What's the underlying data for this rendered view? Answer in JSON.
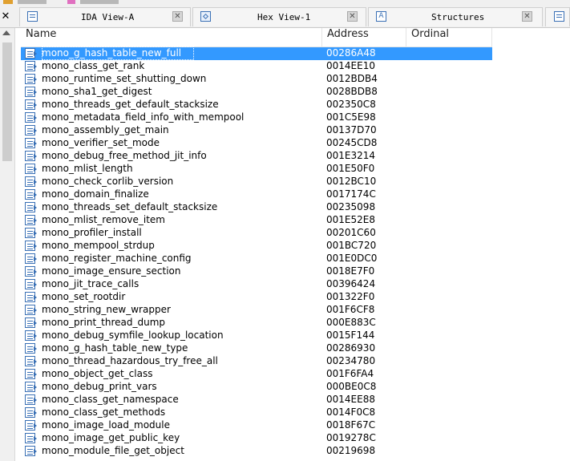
{
  "tabs": [
    {
      "label": "IDA View-A",
      "icon": "ida-view-icon"
    },
    {
      "label": "Hex View-1",
      "icon": "hex-view-icon"
    },
    {
      "label": "Structures",
      "icon": "structures-icon"
    }
  ],
  "table": {
    "columns": [
      "Name",
      "Address",
      "Ordinal"
    ],
    "selected_index": 0,
    "rows": [
      {
        "name": "mono_g_hash_table_new_full",
        "address": "00286A48",
        "ordinal": ""
      },
      {
        "name": "mono_class_get_rank",
        "address": "0014EE10",
        "ordinal": ""
      },
      {
        "name": "mono_runtime_set_shutting_down",
        "address": "0012BDB4",
        "ordinal": ""
      },
      {
        "name": "mono_sha1_get_digest",
        "address": "0028BDB8",
        "ordinal": ""
      },
      {
        "name": "mono_threads_get_default_stacksize",
        "address": "002350C8",
        "ordinal": ""
      },
      {
        "name": "mono_metadata_field_info_with_mempool",
        "address": "001C5E98",
        "ordinal": ""
      },
      {
        "name": "mono_assembly_get_main",
        "address": "00137D70",
        "ordinal": ""
      },
      {
        "name": "mono_verifier_set_mode",
        "address": "00245CD8",
        "ordinal": ""
      },
      {
        "name": "mono_debug_free_method_jit_info",
        "address": "001E3214",
        "ordinal": ""
      },
      {
        "name": "mono_mlist_length",
        "address": "001E50F0",
        "ordinal": ""
      },
      {
        "name": "mono_check_corlib_version",
        "address": "0012BC10",
        "ordinal": ""
      },
      {
        "name": "mono_domain_finalize",
        "address": "0017174C",
        "ordinal": ""
      },
      {
        "name": "mono_threads_set_default_stacksize",
        "address": "00235098",
        "ordinal": ""
      },
      {
        "name": "mono_mlist_remove_item",
        "address": "001E52E8",
        "ordinal": ""
      },
      {
        "name": "mono_profiler_install",
        "address": "00201C60",
        "ordinal": ""
      },
      {
        "name": "mono_mempool_strdup",
        "address": "001BC720",
        "ordinal": ""
      },
      {
        "name": "mono_register_machine_config",
        "address": "001E0DC0",
        "ordinal": ""
      },
      {
        "name": "mono_image_ensure_section",
        "address": "0018E7F0",
        "ordinal": ""
      },
      {
        "name": "mono_jit_trace_calls",
        "address": "00396424",
        "ordinal": ""
      },
      {
        "name": "mono_set_rootdir",
        "address": "001322F0",
        "ordinal": ""
      },
      {
        "name": "mono_string_new_wrapper",
        "address": "001F6CF8",
        "ordinal": ""
      },
      {
        "name": "mono_print_thread_dump",
        "address": "000E883C",
        "ordinal": ""
      },
      {
        "name": "mono_debug_symfile_lookup_location",
        "address": "0015F144",
        "ordinal": ""
      },
      {
        "name": "mono_g_hash_table_new_type",
        "address": "00286930",
        "ordinal": ""
      },
      {
        "name": "mono_thread_hazardous_try_free_all",
        "address": "00234780",
        "ordinal": ""
      },
      {
        "name": "mono_object_get_class",
        "address": "001F6FA4",
        "ordinal": ""
      },
      {
        "name": "mono_debug_print_vars",
        "address": "000BE0C8",
        "ordinal": ""
      },
      {
        "name": "mono_class_get_namespace",
        "address": "0014EE88",
        "ordinal": ""
      },
      {
        "name": "mono_class_get_methods",
        "address": "0014F0C8",
        "ordinal": ""
      },
      {
        "name": "mono_image_load_module",
        "address": "0018F67C",
        "ordinal": ""
      },
      {
        "name": "mono_image_get_public_key",
        "address": "0019278C",
        "ordinal": ""
      },
      {
        "name": "mono_module_file_get_object",
        "address": "00219698",
        "ordinal": ""
      }
    ]
  },
  "colors": {
    "selection": "#3399ff",
    "tab_background": "#f5f5f5",
    "toolbar_background": "#f0f0f0"
  }
}
